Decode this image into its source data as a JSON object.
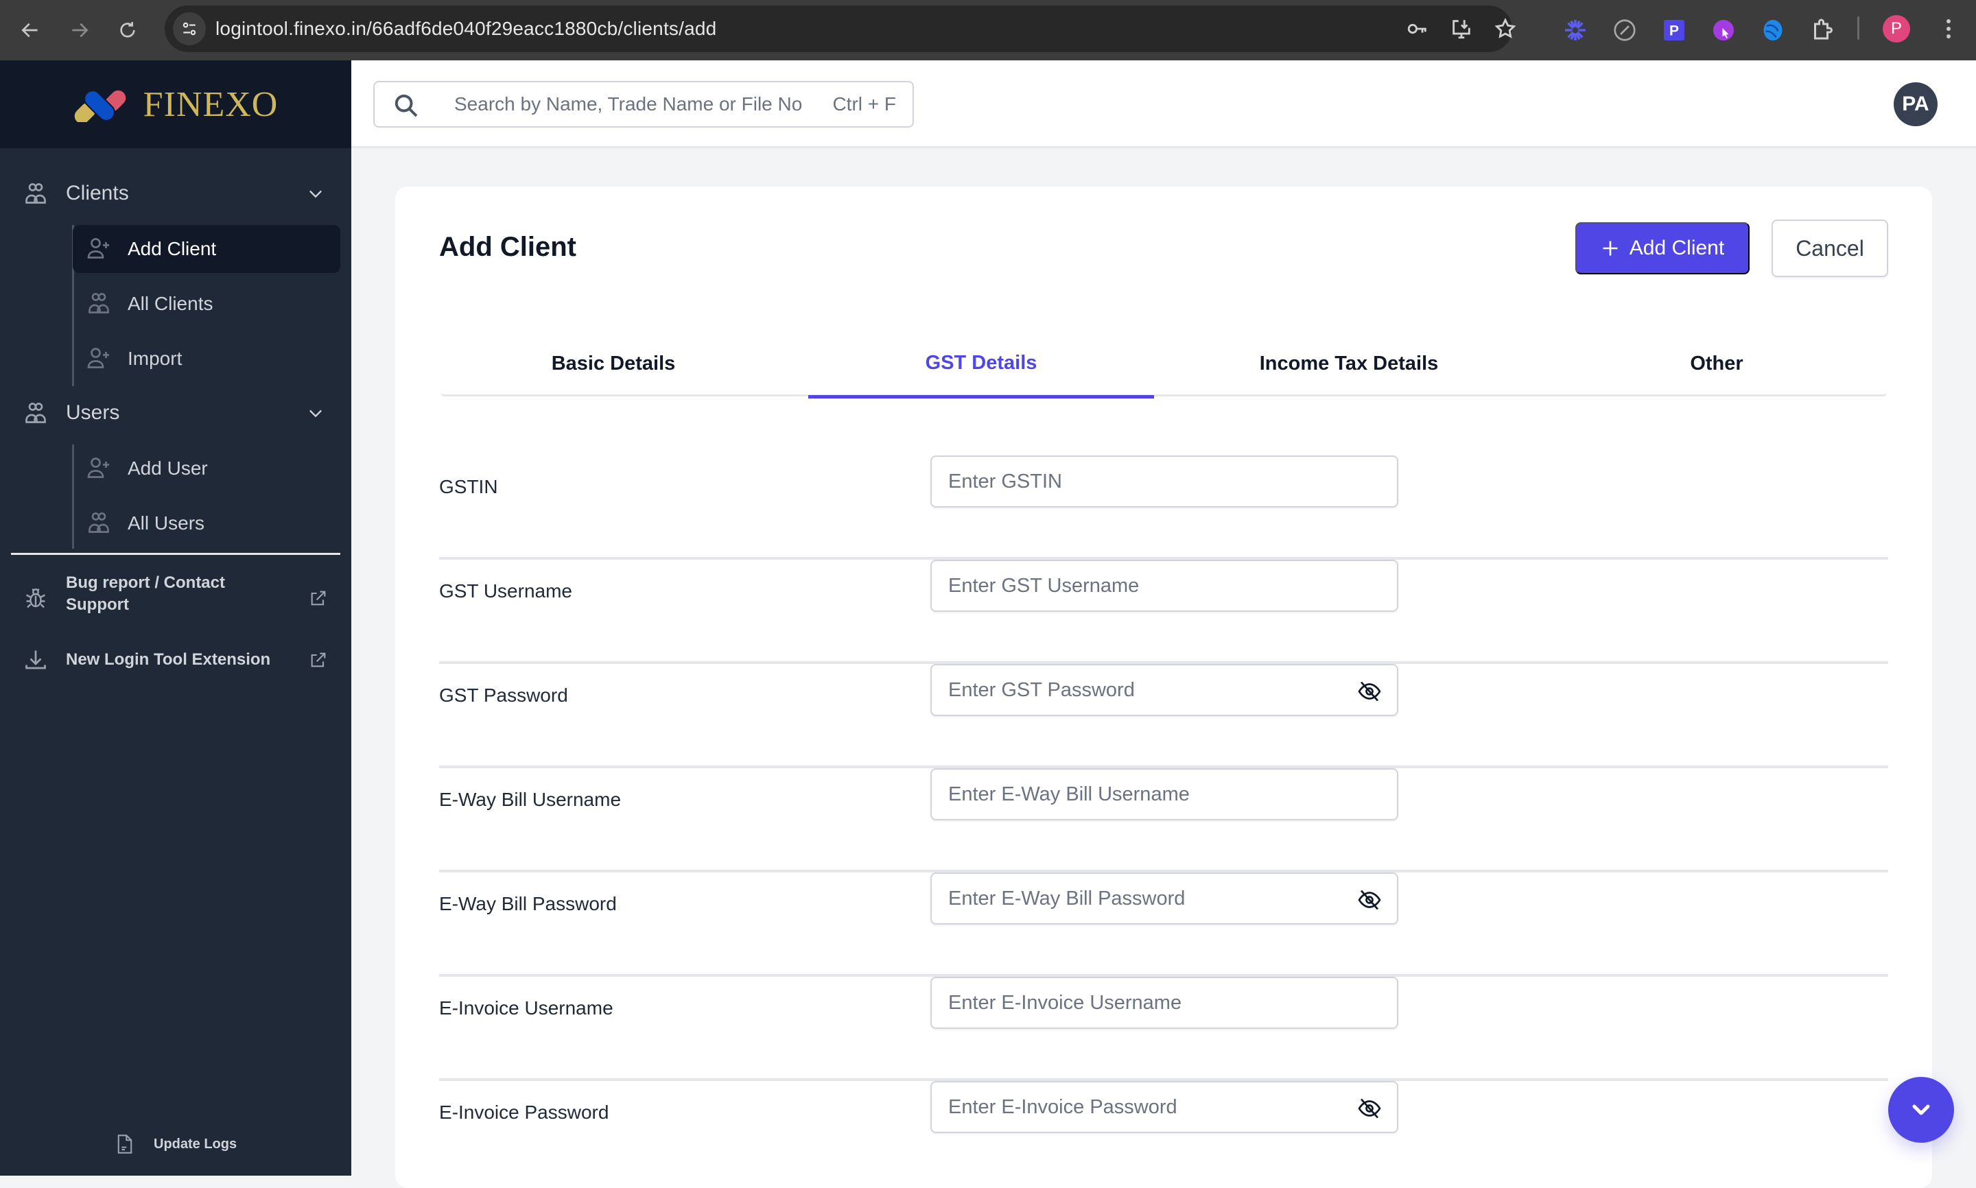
{
  "browser": {
    "url": "logintool.finexo.in/66adf6de040f29eacc1880cb/clients/add",
    "profile_initial": "P",
    "extensions": [
      "sparkle-extension",
      "ruler-extension",
      "p-extension",
      "cursor-extension",
      "globe-extension",
      "puzzle-extensions-menu"
    ]
  },
  "sidebar": {
    "brand": "FINEXO",
    "groups": [
      {
        "label": "Clients",
        "icon": "users-icon",
        "items": [
          {
            "label": "Add Client",
            "icon": "user-plus-icon",
            "active": true
          },
          {
            "label": "All Clients",
            "icon": "users-icon",
            "active": false
          },
          {
            "label": "Import",
            "icon": "user-plus-icon",
            "active": false
          }
        ]
      },
      {
        "label": "Users",
        "icon": "users-icon",
        "items": [
          {
            "label": "Add User",
            "icon": "user-plus-icon",
            "active": false
          },
          {
            "label": "All Users",
            "icon": "users-icon",
            "active": false
          }
        ]
      }
    ],
    "links": [
      {
        "label_line1": "Bug report / Contact",
        "label_line2": "Support",
        "icon": "bug-icon"
      },
      {
        "label_line1": "New Login Tool Extension",
        "label_line2": "",
        "icon": "download-icon"
      }
    ],
    "footer": {
      "label": "Update Logs",
      "icon": "document-icon"
    }
  },
  "header": {
    "search_placeholder": "Search by Name, Trade Name or File No",
    "search_shortcut": "Ctrl + F",
    "avatar_initials": "PA"
  },
  "page": {
    "title": "Add Client",
    "primary_button": "Add Client",
    "secondary_button": "Cancel",
    "accent_color": "#4f46e5",
    "tabs": [
      {
        "label": "Basic Details",
        "active": false
      },
      {
        "label": "GST Details",
        "active": true
      },
      {
        "label": "Income Tax Details",
        "active": false
      },
      {
        "label": "Other",
        "active": false
      }
    ],
    "fields": [
      {
        "label": "GSTIN",
        "placeholder": "Enter GSTIN",
        "value": "",
        "password": false
      },
      {
        "label": "GST Username",
        "placeholder": "Enter GST Username",
        "value": "",
        "password": false
      },
      {
        "label": "GST Password",
        "placeholder": "Enter GST Password",
        "value": "",
        "password": true
      },
      {
        "label": "E-Way Bill Username",
        "placeholder": "Enter E-Way Bill Username",
        "value": "",
        "password": false
      },
      {
        "label": "E-Way Bill Password",
        "placeholder": "Enter E-Way Bill Password",
        "value": "",
        "password": true
      },
      {
        "label": "E-Invoice Username",
        "placeholder": "Enter E-Invoice Username",
        "value": "",
        "password": false
      },
      {
        "label": "E-Invoice Password",
        "placeholder": "Enter E-Invoice Password",
        "value": "",
        "password": true
      }
    ]
  }
}
